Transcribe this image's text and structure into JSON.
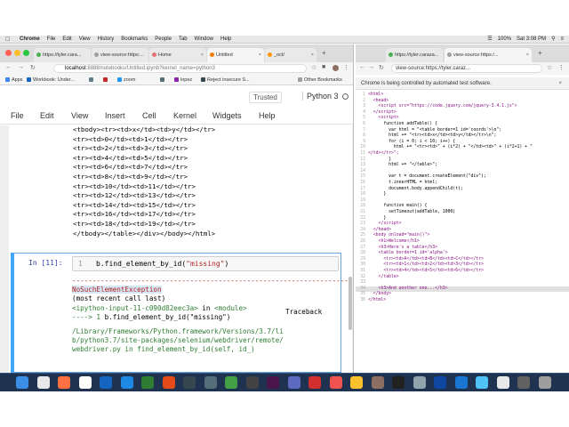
{
  "menubar": {
    "app": "Chrome",
    "menus": [
      "File",
      "Edit",
      "View",
      "History",
      "Bookmarks",
      "People",
      "Tab",
      "Window",
      "Help"
    ],
    "clock": "Sat 3:08 PM",
    "battery": "100%"
  },
  "left_browser": {
    "tabs": [
      {
        "label": "https://tyler.cara...",
        "color": "#4caf50"
      },
      {
        "label": "view-source:https:...",
        "color": "#9e9e9e"
      },
      {
        "label": "Home",
        "color": "#e57373"
      },
      {
        "label": "Untitled",
        "color": "#f57c00"
      },
      {
        "label": "_oct/",
        "color": "#ff9800"
      }
    ],
    "url_host": "localhost",
    "url_path": ":8888/notebooks/Untitled.ipynb?kernel_name=python3",
    "bookmarks": [
      {
        "label": "Apps",
        "color": "#4285f4"
      },
      {
        "label": "Workbook: Under...",
        "color": "#1565c0"
      },
      {
        "label": "",
        "color": "#607d8b"
      },
      {
        "label": "",
        "color": "#c62828"
      },
      {
        "label": "zoom",
        "color": "#2196f3"
      },
      {
        "label": "",
        "color": "#546e7a"
      },
      {
        "label": "lopez",
        "color": "#8e24aa"
      },
      {
        "label": "Reject insecure S...",
        "color": "#37474f"
      },
      {
        "label": "Other Bookmarks",
        "color": "#9e9e9e"
      }
    ]
  },
  "jupyter": {
    "trusted": "Trusted",
    "kernel": "Python 3",
    "menu": [
      "File",
      "Edit",
      "View",
      "Insert",
      "Cell",
      "Kernel",
      "Widgets",
      "Help"
    ],
    "output_lines": [
      "<tbody><tr><td>x</td><td>y</td></tr>",
      "<tr><td>0</td><td>1</td></tr>",
      "<tr><td>2</td><td>3</td></tr>",
      "<tr><td>4</td><td>5</td></tr>",
      "<tr><td>6</td><td>7</td></tr>",
      "<tr><td>8</td><td>9</td></tr>",
      "<tr><td>10</td><td>11</td></tr>",
      "<tr><td>12</td><td>13</td></tr>",
      "<tr><td>14</td><td>15</td></tr>",
      "<tr><td>16</td><td>17</td></tr>",
      "<tr><td>18</td><td>19</td></tr>",
      "</tbody></table></div></body></html>"
    ],
    "cell": {
      "prompt": "In [11]:",
      "line_number": "1",
      "code_prefix": "b.find_element_by_id(",
      "code_string": "\"missing\"",
      "code_suffix": ")"
    },
    "error": {
      "dashes": "----------------------------------------------------------------------",
      "exception": "NoSuchElementException",
      "traceback_label": "Traceback",
      "recent": "(most recent call last)",
      "ipython_input": "<ipython-input-11-c090d82eec3a>",
      "in_word": " in ",
      "module": "<module>",
      "arrow": "----> 1 ",
      "arrow_code": "b.find_element_by_id(\"missing\")",
      "path1": "/Library/Frameworks/Python.framework/Versions/3.7/li",
      "path2": "b/python3.7/site-packages/selenium/webdriver/remote/",
      "path3": "webdriver.py in find_element_by_id(self, id_)"
    }
  },
  "right_browser": {
    "tabs": [
      {
        "label": "https://tyler.caraza...",
        "color": "#4caf50"
      },
      {
        "label": "view-source:https:/...",
        "color": "#9e9e9e"
      }
    ],
    "url": "view-source:https://tyler.caraz...",
    "infobar": "Chrome is being controlled by automated test software.",
    "source_lines": [
      {
        "n": "1",
        "html": "<html>"
      },
      {
        "n": "2",
        "html": "  <head>"
      },
      {
        "n": "3",
        "html": "    <script src=\"https://code.jquery.com/jquery-3.4.1.js\">"
      },
      {
        "n": "4",
        "html": "  </script>"
      },
      {
        "n": "5",
        "html": "    <script>"
      },
      {
        "n": "6",
        "html": "      function addTable() {"
      },
      {
        "n": "7",
        "html": "        var html = \"<table border=1 id='coords'>\\n\";"
      },
      {
        "n": "8",
        "html": "        html += \"<tr><td>x</td><td>y</td></tr>\\n\";"
      },
      {
        "n": "9",
        "html": "        for (i = 0; i < 10; i++) {"
      },
      {
        "n": "10",
        "html": "          html += \"<tr><td>\" + (i*2) + \"</td><td>\" + (i*2+1) + \""
      },
      {
        "n": "11",
        "html": "</td></tr>\";"
      },
      {
        "n": "12",
        "html": "        }"
      },
      {
        "n": "13",
        "html": "        html += \"</table>\";"
      },
      {
        "n": "14",
        "html": ""
      },
      {
        "n": "15",
        "html": "        var t = document.createElement(\"div\");"
      },
      {
        "n": "16",
        "html": "        t.innerHTML = html;"
      },
      {
        "n": "17",
        "html": "        document.body.appendChild(t);"
      },
      {
        "n": "18",
        "html": "      }"
      },
      {
        "n": "19",
        "html": ""
      },
      {
        "n": "20",
        "html": "      function main() {"
      },
      {
        "n": "21",
        "html": "        setTimeout(addTable, 1000)"
      },
      {
        "n": "22",
        "html": "      }"
      },
      {
        "n": "23",
        "html": "    </script>"
      },
      {
        "n": "24",
        "html": "  </head>"
      },
      {
        "n": "25",
        "html": "  <body onload=\"main()\">"
      },
      {
        "n": "26",
        "html": "    <h1>Welcome</h1>"
      },
      {
        "n": "27",
        "html": "    <h3>Here's a table</h3>"
      },
      {
        "n": "28",
        "html": "    <table border=1 id='alpha'>"
      },
      {
        "n": "29",
        "html": "      <tr><td>A</td><td>B</td><td>C</td></tr>"
      },
      {
        "n": "30",
        "html": "      <tr><td>1</td><td>2</td><td>3</td></tr>"
      },
      {
        "n": "31",
        "html": "      <tr><td>4</td><td>5</td><td>6</td></tr>"
      },
      {
        "n": "32",
        "html": "    </table>"
      },
      {
        "n": "33",
        "html": ""
      },
      {
        "n": "34",
        "html": "    <h3>And another one...</h3>"
      },
      {
        "n": "35",
        "html": "  </body>"
      },
      {
        "n": "36",
        "html": "</html>"
      }
    ],
    "highlighted_line": "34"
  },
  "dock": {
    "icons": [
      {
        "name": "finder-icon",
        "color": "#3a8ee6"
      },
      {
        "name": "chrome-icon",
        "color": "#e8e8e8"
      },
      {
        "name": "firefox-icon",
        "color": "#ff7043"
      },
      {
        "name": "app-icon",
        "color": "#ffffff"
      },
      {
        "name": "outlook-icon",
        "color": "#1565c0"
      },
      {
        "name": "word-icon",
        "color": "#1e88e5"
      },
      {
        "name": "excel-icon",
        "color": "#2e7d32"
      },
      {
        "name": "powerpoint-icon",
        "color": "#e64a19"
      },
      {
        "name": "app-icon",
        "color": "#37474f"
      },
      {
        "name": "app-icon",
        "color": "#546e7a"
      },
      {
        "name": "app-icon",
        "color": "#43a047"
      },
      {
        "name": "app-icon",
        "color": "#424242"
      },
      {
        "name": "slack-icon",
        "color": "#4a154b"
      },
      {
        "name": "app-icon",
        "color": "#5c6bc0"
      },
      {
        "name": "acrobat-icon",
        "color": "#d32f2f"
      },
      {
        "name": "app-icon",
        "color": "#ef5350"
      },
      {
        "name": "app-icon",
        "color": "#fbc02d"
      },
      {
        "name": "app-icon",
        "color": "#8d6e63"
      },
      {
        "name": "terminal-icon",
        "color": "#212121"
      },
      {
        "name": "app-icon",
        "color": "#90a4ae"
      },
      {
        "name": "app-icon",
        "color": "#0d47a1"
      },
      {
        "name": "app-icon",
        "color": "#1976d2"
      },
      {
        "name": "app-icon",
        "color": "#4fc3f7"
      },
      {
        "name": "chrome-icon",
        "color": "#e8e8e8"
      },
      {
        "name": "app-icon",
        "color": "#616161"
      },
      {
        "name": "trash-icon",
        "color": "#9e9e9e"
      }
    ]
  }
}
